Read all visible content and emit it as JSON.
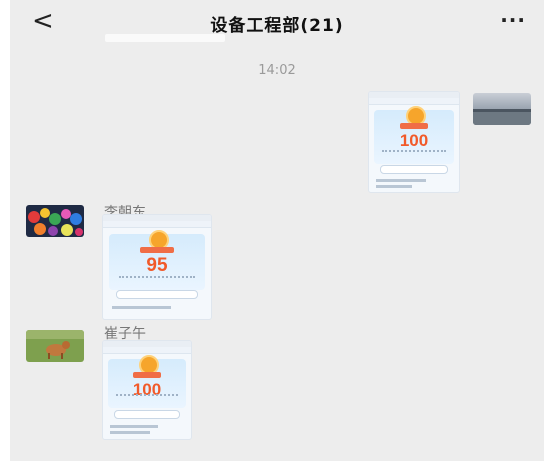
{
  "header": {
    "back_icon": "back-chevron-icon",
    "title": "设备工程部(21)",
    "more_icon": "more-icon"
  },
  "timestamp": "14:02",
  "messages": [
    {
      "side": "right",
      "sender": "",
      "type": "image",
      "score": "100",
      "avatar_icon": "avatar-lake-photo"
    },
    {
      "side": "left",
      "sender": "李朝东",
      "type": "image",
      "score": "95",
      "avatar_icon": "avatar-colorful-toys"
    },
    {
      "side": "left",
      "sender": "崔子午",
      "type": "image",
      "score": "100",
      "avatar_icon": "avatar-dog-grass"
    }
  ],
  "colors": {
    "background": "#ededed",
    "score": "#f15a2a",
    "accent": "#f6a52b"
  }
}
